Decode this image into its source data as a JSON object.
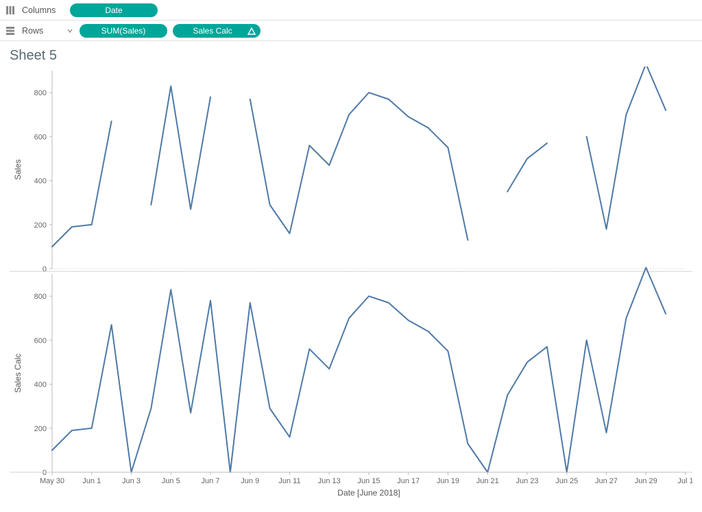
{
  "shelves": {
    "columns_label": "Columns",
    "rows_label": "Rows",
    "columns_pills": [
      {
        "label": "Date"
      }
    ],
    "rows_pills": [
      {
        "label": "SUM(Sales)"
      },
      {
        "label": "Sales Calc",
        "calc_icon": true
      }
    ]
  },
  "sheet": {
    "title": "Sheet 5"
  },
  "axis_titles": {
    "y1": "Sales",
    "y2": "Sales Calc",
    "x": "Date [June 2018]"
  },
  "chart_data": [
    {
      "type": "line",
      "title": "Sales",
      "xlabel": "Date [June 2018]",
      "ylabel": "Sales",
      "ylim": [
        0,
        900
      ],
      "x": [
        "May 30",
        "May 31",
        "Jun 1",
        "Jun 2",
        "Jun 3",
        "Jun 4",
        "Jun 5",
        "Jun 6",
        "Jun 7",
        "Jun 8",
        "Jun 9",
        "Jun 10",
        "Jun 11",
        "Jun 12",
        "Jun 13",
        "Jun 14",
        "Jun 15",
        "Jun 16",
        "Jun 17",
        "Jun 18",
        "Jun 19",
        "Jun 20",
        "Jun 21",
        "Jun 22",
        "Jun 23",
        "Jun 24",
        "Jun 25",
        "Jun 26",
        "Jun 27",
        "Jun 28",
        "Jun 29",
        "Jun 30",
        "Jul 1"
      ],
      "values": [
        100,
        190,
        200,
        670,
        null,
        290,
        830,
        270,
        780,
        null,
        770,
        290,
        160,
        560,
        470,
        700,
        800,
        770,
        690,
        640,
        550,
        130,
        null,
        350,
        500,
        570,
        null,
        600,
        180,
        700,
        930,
        720,
        null
      ],
      "y_ticks": [
        0,
        200,
        400,
        600,
        800
      ],
      "x_ticks": [
        "May 30",
        "Jun 1",
        "Jun 3",
        "Jun 5",
        "Jun 7",
        "Jun 9",
        "Jun 11",
        "Jun 13",
        "Jun 15",
        "Jun 17",
        "Jun 19",
        "Jun 21",
        "Jun 23",
        "Jun 25",
        "Jun 27",
        "Jun 29",
        "Jul 1"
      ]
    },
    {
      "type": "line",
      "title": "Sales Calc",
      "xlabel": "Date [June 2018]",
      "ylabel": "Sales Calc",
      "ylim": [
        0,
        900
      ],
      "x": [
        "May 30",
        "May 31",
        "Jun 1",
        "Jun 2",
        "Jun 3",
        "Jun 4",
        "Jun 5",
        "Jun 6",
        "Jun 7",
        "Jun 8",
        "Jun 9",
        "Jun 10",
        "Jun 11",
        "Jun 12",
        "Jun 13",
        "Jun 14",
        "Jun 15",
        "Jun 16",
        "Jun 17",
        "Jun 18",
        "Jun 19",
        "Jun 20",
        "Jun 21",
        "Jun 22",
        "Jun 23",
        "Jun 24",
        "Jun 25",
        "Jun 26",
        "Jun 27",
        "Jun 28",
        "Jun 29",
        "Jun 30",
        "Jul 1"
      ],
      "values": [
        100,
        190,
        200,
        670,
        0,
        290,
        830,
        270,
        780,
        0,
        770,
        290,
        160,
        560,
        470,
        700,
        800,
        770,
        690,
        640,
        550,
        130,
        0,
        350,
        500,
        570,
        0,
        600,
        180,
        700,
        930,
        720,
        null
      ],
      "y_ticks": [
        0,
        200,
        400,
        600,
        800
      ],
      "x_ticks": [
        "May 30",
        "Jun 1",
        "Jun 3",
        "Jun 5",
        "Jun 7",
        "Jun 9",
        "Jun 11",
        "Jun 13",
        "Jun 15",
        "Jun 17",
        "Jun 19",
        "Jun 21",
        "Jun 23",
        "Jun 25",
        "Jun 27",
        "Jun 29",
        "Jul 1"
      ]
    }
  ]
}
